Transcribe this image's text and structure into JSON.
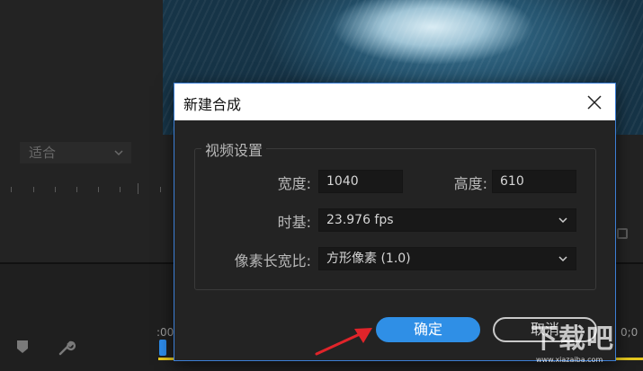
{
  "monitor": {
    "fit_dropdown": "适合"
  },
  "timeline": {
    "timecode_left": ":00",
    "timecode_right": "0;0"
  },
  "dialog": {
    "title": "新建合成",
    "group_title": "视频设置",
    "width_label": "宽度:",
    "width_value": "1040",
    "height_label": "高度:",
    "height_value": "610",
    "timebase_label": "时基:",
    "timebase_value": "23.976 fps",
    "pixel_aspect_label": "像素长宽比:",
    "pixel_aspect_value": "方形像素 (1.0)",
    "ok_label": "确定",
    "cancel_label": "取消"
  },
  "watermark": {
    "text": "下载吧",
    "sub": "www.xiazaiba.com"
  },
  "colors": {
    "accent": "#2f8fe6",
    "arrow": "#e0242a",
    "dialog_border": "#3d7fd6",
    "timeline_yellow": "#e6c81f"
  },
  "icons": {
    "close": "close-icon",
    "dropdown": "chevron-down-icon",
    "marker": "marker-icon",
    "wrench": "wrench-icon"
  }
}
